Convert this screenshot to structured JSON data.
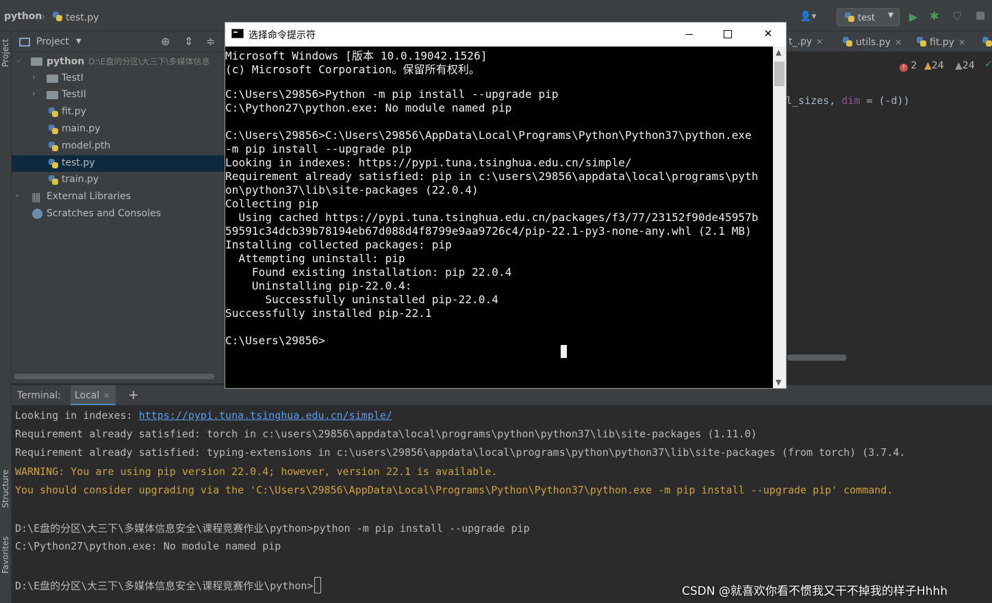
{
  "navbar": {
    "project_name": "python",
    "breadcrumb_file": "test.py",
    "run_config": "test"
  },
  "project_panel": {
    "title": "Project",
    "root": {
      "name": "python",
      "path": "D:\\E盘的分区\\大三下\\多媒体信息"
    },
    "items": [
      {
        "label": "TestI",
        "kind": "folder"
      },
      {
        "label": "TestII",
        "kind": "folder"
      },
      {
        "label": "fit.py",
        "kind": "py"
      },
      {
        "label": "main.py",
        "kind": "py"
      },
      {
        "label": "model.pth",
        "kind": "file"
      },
      {
        "label": "test.py",
        "kind": "py",
        "selected": true
      },
      {
        "label": "train.py",
        "kind": "py"
      }
    ],
    "external": "External Libraries",
    "scratches": "Scratches and Consoles"
  },
  "left_strip": {
    "project": "Project",
    "structure": "Structure",
    "favorites": "Favorites"
  },
  "editor": {
    "tabs": [
      {
        "label": "t_.py"
      },
      {
        "label": "utils.py"
      },
      {
        "label": "fit.py"
      }
    ],
    "inspections": {
      "errors": "2",
      "warnings": "24",
      "weak_warnings": "24"
    },
    "code_fragment_a": "l_sizes, ",
    "code_fragment_dim": "dim",
    "code_fragment_b": " = (-d))"
  },
  "terminal": {
    "title": "Terminal:",
    "tab": "Local",
    "lines": [
      {
        "pre": "Looking in indexes: ",
        "link": "https://pypi.tuna.tsinghua.edu.cn/simple/"
      },
      {
        "text": "Requirement already satisfied: torch in c:\\users\\29856\\appdata\\local\\programs\\python\\python37\\lib\\site-packages (1.11.0)"
      },
      {
        "text": "Requirement already satisfied: typing-extensions in c:\\users\\29856\\appdata\\local\\programs\\python\\python37\\lib\\site-packages (from torch) (3.7.4."
      },
      {
        "text": "WARNING: You are using pip version 22.0.4; however, version 22.1 is available.",
        "warn": true
      },
      {
        "text": "You should consider upgrading via the 'C:\\Users\\29856\\AppData\\Local\\Programs\\Python\\Python37\\python.exe -m pip install --upgrade pip' command.",
        "warn": true
      },
      {
        "text": "D:\\E盘的分区\\大三下\\多媒体信息安全\\课程竞赛作业\\python>python -m pip install --upgrade pip"
      },
      {
        "text": "C:\\Python27\\python.exe: No module named pip"
      },
      {
        "text": "D:\\E盘的分区\\大三下\\多媒体信息安全\\课程竞赛作业\\python>"
      }
    ]
  },
  "cmd_window": {
    "title": "选择命令提示符",
    "lines": [
      "Microsoft Windows [版本 10.0.19042.1526]",
      "(c) Microsoft Corporation。保留所有权利。",
      "",
      "C:\\Users\\29856>Python -m pip install --upgrade pip",
      "C:\\Python27\\python.exe: No module named pip",
      "",
      "C:\\Users\\29856>C:\\Users\\29856\\AppData\\Local\\Programs\\Python\\Python37\\python.exe",
      "-m pip install --upgrade pip",
      "Looking in indexes: https://pypi.tuna.tsinghua.edu.cn/simple/",
      "Requirement already satisfied: pip in c:\\users\\29856\\appdata\\local\\programs\\pyth",
      "on\\python37\\lib\\site-packages (22.0.4)",
      "Collecting pip",
      "  Using cached https://pypi.tuna.tsinghua.edu.cn/packages/f3/77/23152f90de45957b",
      "59591c34dcb39b78194eb67d088d4f8799e9aa9726c4/pip-22.1-py3-none-any.whl (2.1 MB)",
      "Installing collected packages: pip",
      "  Attempting uninstall: pip",
      "    Found existing installation: pip 22.0.4",
      "    Uninstalling pip-22.0.4:",
      "      Successfully uninstalled pip-22.0.4",
      "Successfully installed pip-22.1",
      "",
      "C:\\Users\\29856>"
    ]
  },
  "watermark": "CSDN @就喜欢你看不惯我又干不掉我的样子Hhhh"
}
